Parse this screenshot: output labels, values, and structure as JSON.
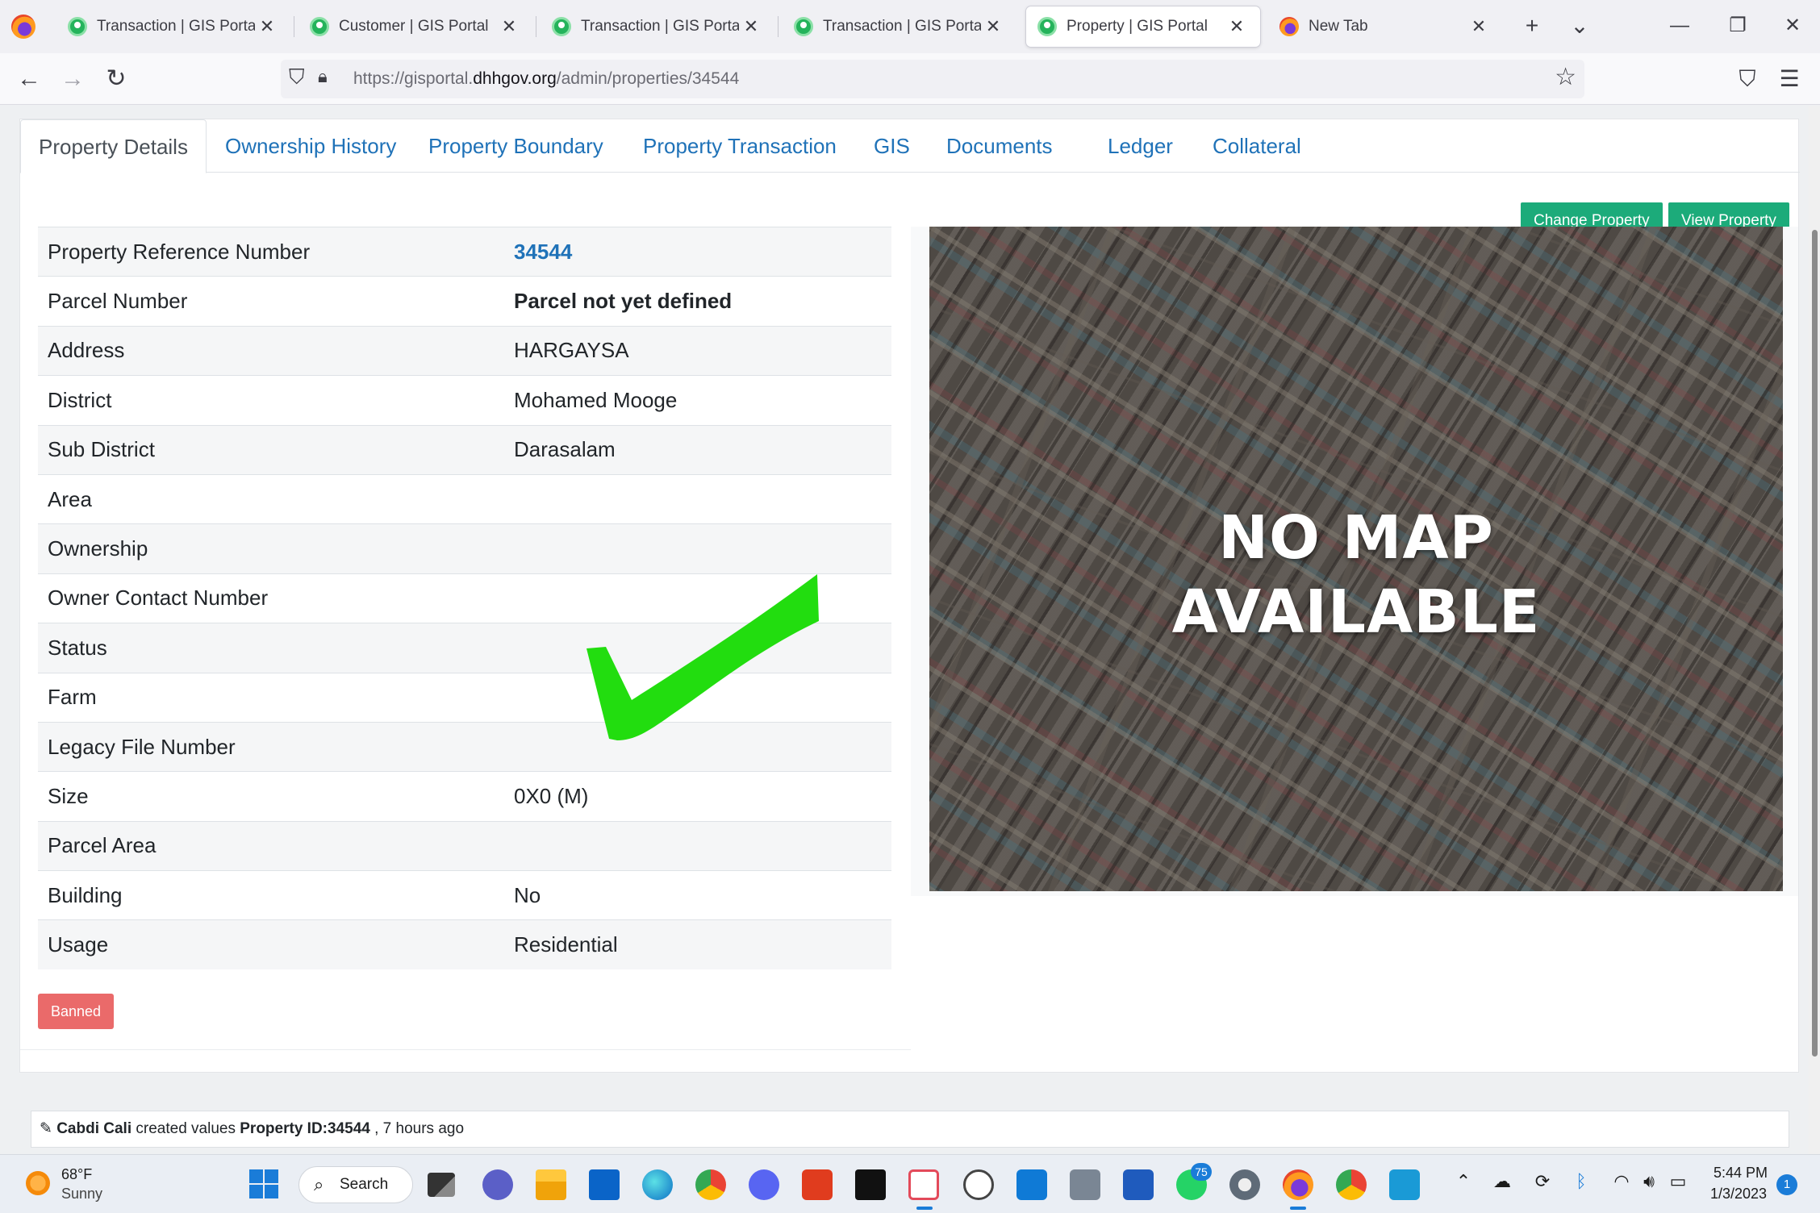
{
  "browser": {
    "tabs": [
      {
        "title": "Transaction | GIS Portal",
        "icon": "gis-portal-icon",
        "active": false
      },
      {
        "title": "Customer | GIS Portal",
        "icon": "gis-portal-icon",
        "active": false
      },
      {
        "title": "Transaction | GIS Portal",
        "icon": "gis-portal-icon",
        "active": false
      },
      {
        "title": "Transaction | GIS Portal",
        "icon": "gis-portal-icon",
        "active": false
      },
      {
        "title": "Property | GIS Portal",
        "icon": "gis-portal-icon",
        "active": true
      },
      {
        "title": "New Tab",
        "icon": "firefox-icon",
        "active": false
      }
    ],
    "tab_close": "✕",
    "new_tab": "+",
    "list_tabs": "⌄",
    "url_prefix": "https://gisportal.",
    "url_domain": "dhhgov.org",
    "url_path": "/admin/properties/34544"
  },
  "page": {
    "tabs": [
      "Property Details",
      "Ownership History",
      "Property Boundary",
      "Property Transaction",
      "GIS",
      "Documents",
      "Ledger",
      "Collateral"
    ],
    "change_property": "Change Property",
    "view_property": "View Property",
    "details": [
      {
        "label": "Property Reference Number",
        "value": "34544"
      },
      {
        "label": "Parcel Number",
        "value": "Parcel not yet defined"
      },
      {
        "label": "Address",
        "value": "HARGAYSA"
      },
      {
        "label": "District",
        "value": "Mohamed Mooge"
      },
      {
        "label": "Sub District",
        "value": "Darasalam"
      },
      {
        "label": "Area",
        "value": ""
      },
      {
        "label": "Ownership",
        "value": ""
      },
      {
        "label": "Owner Contact Number",
        "value": ""
      },
      {
        "label": "Status",
        "value": ""
      },
      {
        "label": "Farm",
        "value": ""
      },
      {
        "label": "Legacy File Number",
        "value": ""
      },
      {
        "label": "Size",
        "value": "0X0 (M)"
      },
      {
        "label": "Parcel Area",
        "value": ""
      },
      {
        "label": "Building",
        "value": "No"
      },
      {
        "label": "Usage",
        "value": "Residential"
      }
    ],
    "banned": "Banned",
    "map_text_line1": "NO MAP",
    "map_text_line2": "AVAILABLE",
    "activity": {
      "user": "Cabdi Cali",
      "action": " created values ",
      "subject": "Property ID:34544",
      "time": " , 7 hours ago"
    }
  },
  "taskbar": {
    "temp": "68°F",
    "weather": "Sunny",
    "search": "Search",
    "whatsapp_badge": "75",
    "time": "5:44 PM",
    "date": "1/3/2023",
    "notifications": "1"
  },
  "colors": {
    "accent": "#1f72b8",
    "success": "#1cab7a",
    "danger": "#ea6a6a",
    "checkmark": "#22dd0f"
  }
}
